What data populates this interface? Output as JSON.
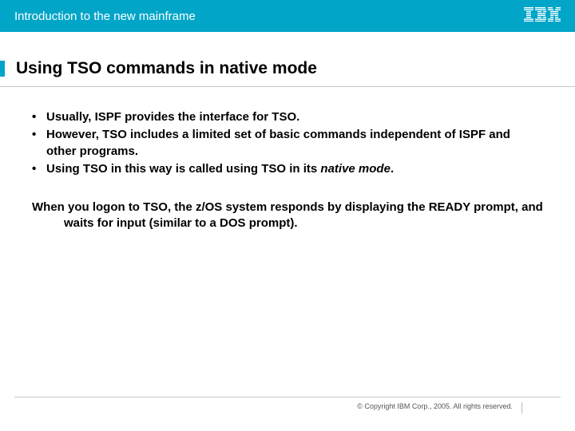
{
  "header": {
    "title": "Introduction to the new mainframe",
    "logo_name": "ibm-logo"
  },
  "slide": {
    "title": "Using TSO commands in native mode",
    "bullets": [
      "Usually, ISPF provides the interface for TSO.",
      "However, TSO includes a limited set of basic commands independent of ISPF and other programs.",
      "Using TSO in this way is called using TSO in its "
    ],
    "bullet3_italic": "native mode",
    "bullet3_tail": ".",
    "paragraph": "When you logon to TSO, the z/OS system responds by displaying the READY prompt, and waits for input (similar to a DOS prompt)."
  },
  "footer": {
    "copyright": "© Copyright IBM Corp., 2005. All rights reserved."
  }
}
